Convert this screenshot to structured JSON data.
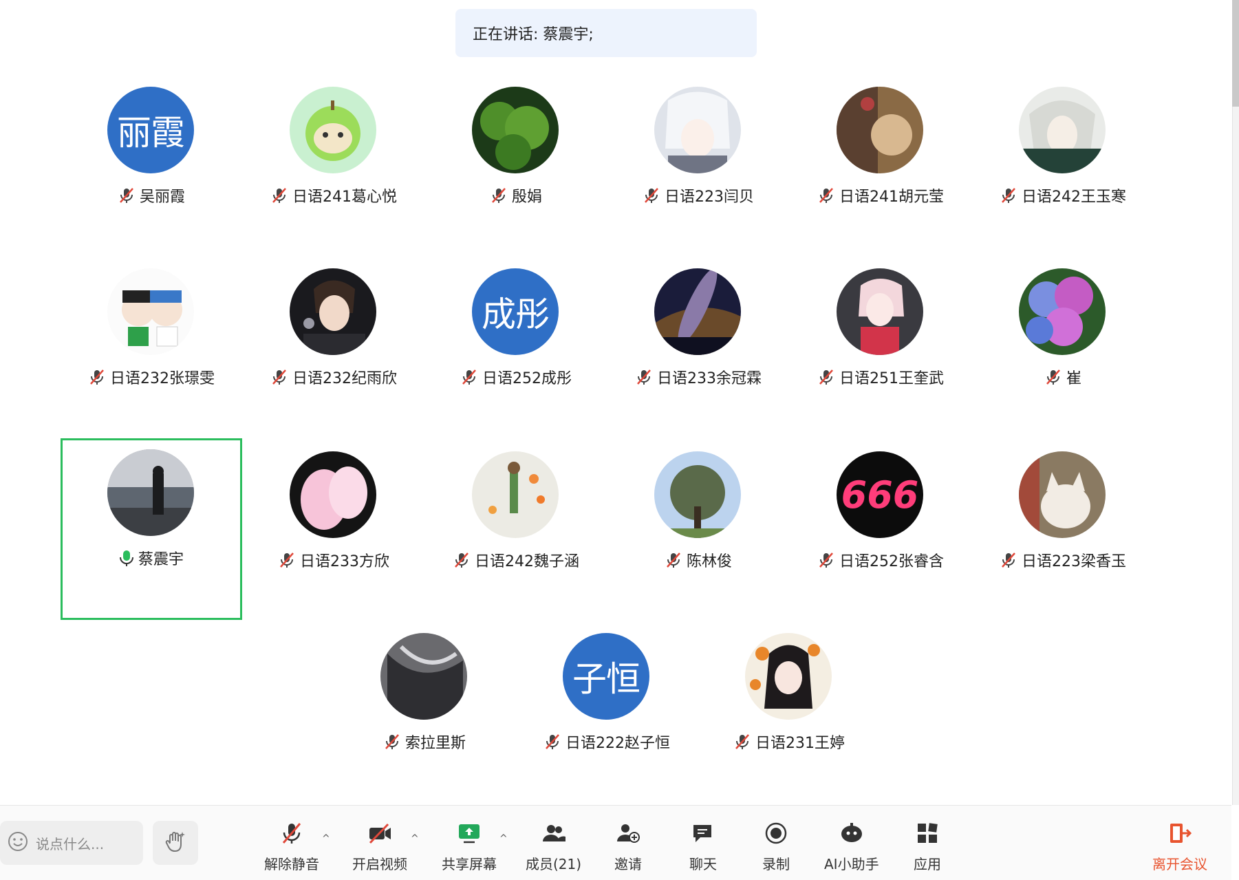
{
  "speaking": {
    "label": "正在讲话: 蔡震宇;"
  },
  "participants": [
    {
      "name": "吴丽霞",
      "avatar_text": "丽霞",
      "muted": true
    },
    {
      "name": "日语241葛心悦",
      "muted": true
    },
    {
      "name": "殷娟",
      "muted": true
    },
    {
      "name": "日语223闫贝",
      "muted": true
    },
    {
      "name": "日语241胡元莹",
      "muted": true
    },
    {
      "name": "日语242王玉寒",
      "muted": true
    },
    {
      "name": "日语232张璟雯",
      "muted": true
    },
    {
      "name": "日语232纪雨欣",
      "muted": true
    },
    {
      "name": "日语252成彤",
      "avatar_text": "成彤",
      "muted": true
    },
    {
      "name": "日语233余冠霖",
      "muted": true
    },
    {
      "name": "日语251王奎武",
      "muted": true
    },
    {
      "name": "崔",
      "muted": true
    },
    {
      "name": "蔡震宇",
      "muted": false,
      "speaking": true
    },
    {
      "name": "日语233方欣",
      "muted": true
    },
    {
      "name": "日语242魏子涵",
      "muted": true
    },
    {
      "name": "陈林俊",
      "muted": true
    },
    {
      "name": "日语252张睿含",
      "avatar_text": "666",
      "muted": true
    },
    {
      "name": "日语223梁香玉",
      "muted": true
    },
    {
      "name": "索拉里斯",
      "muted": true
    },
    {
      "name": "日语222赵子恒",
      "avatar_text": "子恒",
      "muted": true
    },
    {
      "name": "日语231王婷",
      "muted": true
    }
  ],
  "toolbar": {
    "chat_placeholder": "说点什么...",
    "unmute": "解除静音",
    "start_video": "开启视频",
    "share_screen": "共享屏幕",
    "members": "成员(21)",
    "invite": "邀请",
    "chat": "聊天",
    "record": "录制",
    "ai_assistant": "AI小助手",
    "apps": "应用",
    "leave": "离开会议"
  },
  "colors": {
    "accent_green": "#2bbd5d",
    "avatar_blue": "#2f6fc6",
    "leave_red": "#e8542f",
    "mic_red": "#e0483a"
  }
}
